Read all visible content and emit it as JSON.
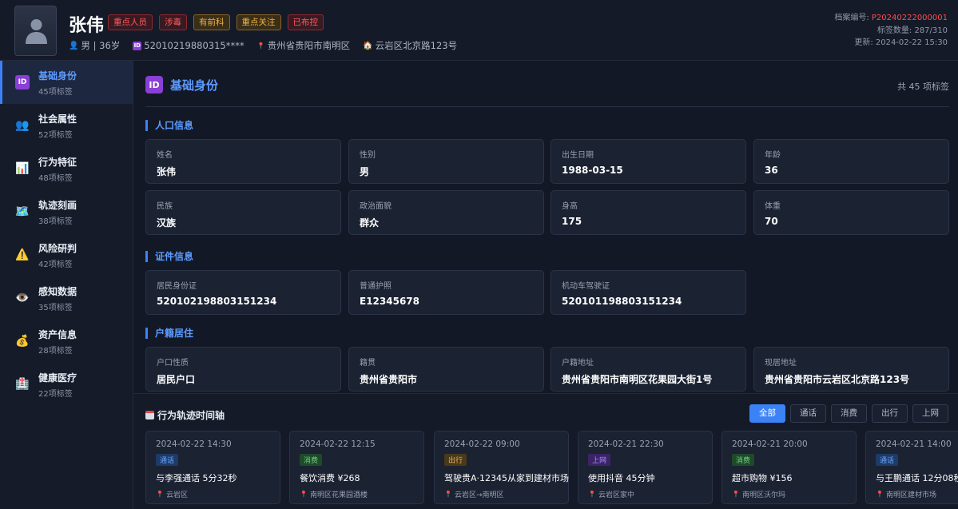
{
  "header": {
    "name": "张伟",
    "tags": [
      {
        "label": "重点人员",
        "color": "red"
      },
      {
        "label": "涉毒",
        "color": "red"
      },
      {
        "label": "有前科",
        "color": "orange"
      },
      {
        "label": "重点关注",
        "color": "orange"
      },
      {
        "label": "已布控",
        "color": "red"
      }
    ],
    "gender_age": "男 | 36岁",
    "id_number": "52010219880315****",
    "origin": "贵州省贵阳市南明区",
    "residence": "云岩区北京路123号",
    "archive_label": "档案编号: ",
    "archive_code": "P20240222000001",
    "tag_count": "标签数量: 287/310",
    "updated": "更新: 2024-02-22 15:30"
  },
  "sidebar": {
    "items": [
      {
        "label": "基础身份",
        "sub": "45项标签",
        "icon": "id-icon",
        "active": true
      },
      {
        "label": "社会属性",
        "sub": "52项标签",
        "icon": "people-icon"
      },
      {
        "label": "行为特征",
        "sub": "48项标签",
        "icon": "bar-chart-icon"
      },
      {
        "label": "轨迹刻画",
        "sub": "38项标签",
        "icon": "map-icon"
      },
      {
        "label": "风险研判",
        "sub": "42项标签",
        "icon": "warning-icon"
      },
      {
        "label": "感知数据",
        "sub": "35项标签",
        "icon": "eye-icon"
      },
      {
        "label": "资产信息",
        "sub": "28项标签",
        "icon": "money-bag-icon"
      },
      {
        "label": "健康医疗",
        "sub": "22项标签",
        "icon": "hospital-icon"
      }
    ]
  },
  "main": {
    "title": "基础身份",
    "count": "共 45 项标签",
    "groups": [
      {
        "title": "人口信息",
        "fields": [
          {
            "label": "姓名",
            "value": "张伟"
          },
          {
            "label": "性别",
            "value": "男"
          },
          {
            "label": "出生日期",
            "value": "1988-03-15"
          },
          {
            "label": "年龄",
            "value": "36"
          },
          {
            "label": "民族",
            "value": "汉族"
          },
          {
            "label": "政治面貌",
            "value": "群众"
          },
          {
            "label": "身高",
            "value": "175"
          },
          {
            "label": "体重",
            "value": "70"
          }
        ]
      },
      {
        "title": "证件信息",
        "fields": [
          {
            "label": "居民身份证",
            "value": "520102198803151234"
          },
          {
            "label": "普通护照",
            "value": "E12345678"
          },
          {
            "label": "机动车驾驶证",
            "value": "520101198803151234"
          }
        ]
      },
      {
        "title": "户籍居住",
        "fields": [
          {
            "label": "户口性质",
            "value": "居民户口"
          },
          {
            "label": "籍贯",
            "value": "贵州省贵阳市"
          },
          {
            "label": "户籍地址",
            "value": "贵州省贵阳市南明区花果园大街1号"
          },
          {
            "label": "现居地址",
            "value": "贵州省贵阳市云岩区北京路123号"
          }
        ]
      }
    ]
  },
  "timeline": {
    "title": "行为轨迹时间轴",
    "filters": [
      "全部",
      "通话",
      "消费",
      "出行",
      "上网"
    ],
    "events": [
      {
        "time": "2024-02-22 14:30",
        "type": "通话",
        "cls": "b-call",
        "desc": "与李强通话 5分32秒",
        "loc": "云岩区"
      },
      {
        "time": "2024-02-22 12:15",
        "type": "消费",
        "cls": "b-cons",
        "desc": "餐饮消费 ¥268",
        "loc": "南明区花果园酒楼"
      },
      {
        "time": "2024-02-22 09:00",
        "type": "出行",
        "cls": "b-trip",
        "desc": "驾驶贵A·12345从家到建材市场",
        "loc": "云岩区→南明区"
      },
      {
        "time": "2024-02-21 22:30",
        "type": "上网",
        "cls": "b-net",
        "desc": "使用抖音 45分钟",
        "loc": "云岩区家中"
      },
      {
        "time": "2024-02-21 20:00",
        "type": "消费",
        "cls": "b-cons",
        "desc": "超市购物 ¥156",
        "loc": "南明区沃尔玛"
      },
      {
        "time": "2024-02-21 14:00",
        "type": "通话",
        "cls": "b-call",
        "desc": "与王鹏通话 12分08秒",
        "loc": "南明区建材市场"
      }
    ]
  }
}
